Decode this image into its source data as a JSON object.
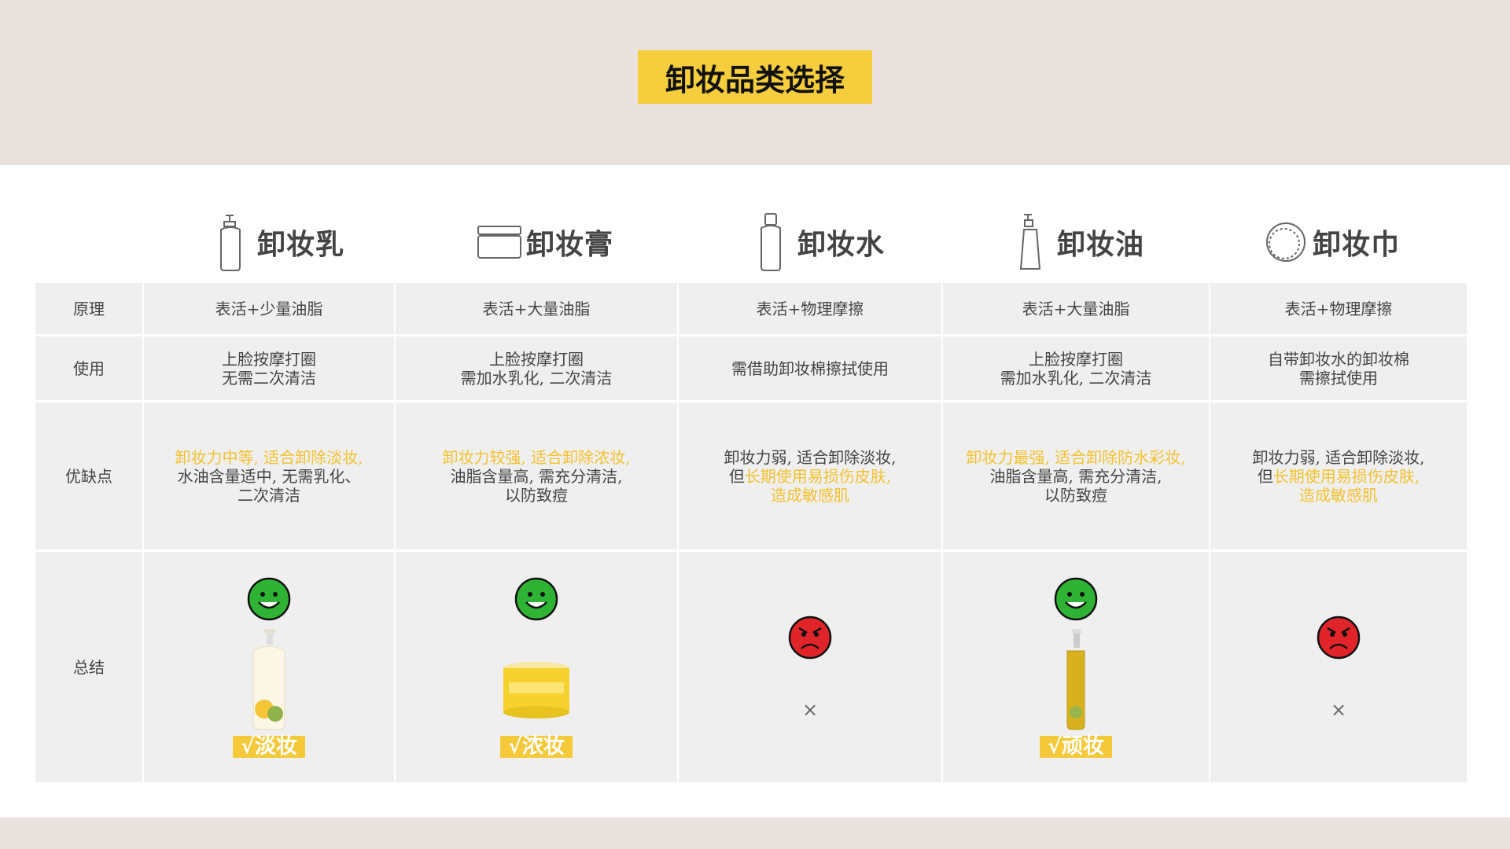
{
  "title": "卸妆品类选择",
  "products": [
    {
      "name": "卸妆乳",
      "icon": "pump-bottle-icon"
    },
    {
      "name": "卸妆膏",
      "icon": "jar-icon"
    },
    {
      "name": "卸妆水",
      "icon": "bottle-icon"
    },
    {
      "name": "卸妆油",
      "icon": "pump-tall-bottle-icon"
    },
    {
      "name": "卸妆巾",
      "icon": "wipe-pad-icon"
    }
  ],
  "rows": {
    "principle": {
      "label": "原理",
      "cells": [
        "表活+少量油脂",
        "表活+大量油脂",
        "表活+物理摩擦",
        "表活+大量油脂",
        "表活+物理摩擦"
      ]
    },
    "usage": {
      "label": "使用",
      "cells": [
        [
          "上脸按摩打圈",
          "无需二次清洁"
        ],
        [
          "上脸按摩打圈",
          "需加水乳化, 二次清洁"
        ],
        [
          "需借助卸妆棉擦拭使用"
        ],
        [
          "上脸按摩打圈",
          "需加水乳化, 二次清洁"
        ],
        [
          "自带卸妆水的卸妆棉",
          "需擦拭使用"
        ]
      ]
    },
    "pros_cons": {
      "label": "优缺点",
      "cells": [
        {
          "highlight": "卸妆力中等, 适合卸除淡妆,",
          "rest": [
            "水油含量适中, 无需乳化、",
            "二次清洁"
          ]
        },
        {
          "highlight": "卸妆力较强, 适合卸除浓妆,",
          "rest": [
            "油脂含量高, 需充分清洁,",
            "以防致痘"
          ]
        },
        {
          "plain": "卸妆力弱, 适合卸除淡妆,",
          "prefix": "但",
          "highlight": "长期使用易损伤皮肤,",
          "highlight2": "造成敏感肌"
        },
        {
          "highlight": "卸妆力最强, 适合卸除防水彩妆,",
          "rest": [
            "油脂含量高, 需充分清洁,",
            "以防致痘"
          ]
        },
        {
          "plain": "卸妆力弱, 适合卸除淡妆,",
          "prefix": "但",
          "highlight": "长期使用易损伤皮肤,",
          "highlight2": "造成敏感肌"
        }
      ]
    },
    "summary": {
      "label": "总结",
      "cells": [
        {
          "face": "happy",
          "tag": "√淡妆"
        },
        {
          "face": "happy",
          "tag": "√浓妆"
        },
        {
          "face": "angry",
          "cross": "×"
        },
        {
          "face": "happy",
          "tag": "√顽妆"
        },
        {
          "face": "angry",
          "cross": "×"
        }
      ]
    }
  },
  "colors": {
    "accent": "#f5cd3d",
    "happy": "#2fb335",
    "angry": "#e0242a",
    "highlight_text": "#f3c230"
  }
}
